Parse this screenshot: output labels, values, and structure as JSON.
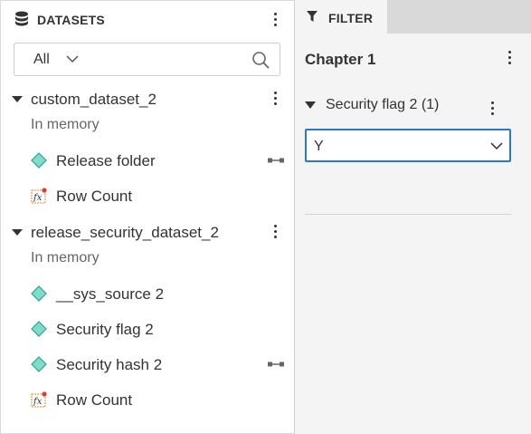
{
  "datasets_panel": {
    "title": "DATASETS",
    "filter": {
      "selected": "All"
    },
    "datasets": [
      {
        "name": "custom_dataset_2",
        "location": "In memory",
        "fields": [
          {
            "label": "Release folder",
            "icon": "attribute-diamond-icon",
            "linked": true
          },
          {
            "label": "Row Count",
            "icon": "fx-metric-icon",
            "linked": false
          }
        ]
      },
      {
        "name": "release_security_dataset_2",
        "location": "In memory",
        "fields": [
          {
            "label": "__sys_source 2",
            "icon": "attribute-diamond-icon",
            "linked": false
          },
          {
            "label": "Security flag 2",
            "icon": "attribute-diamond-icon",
            "linked": false
          },
          {
            "label": "Security hash 2",
            "icon": "attribute-diamond-icon",
            "linked": true
          },
          {
            "label": "Row Count",
            "icon": "fx-metric-icon",
            "linked": false
          }
        ]
      }
    ]
  },
  "filter_panel": {
    "tab_label": "FILTER",
    "chapter_title": "Chapter 1",
    "filter": {
      "name": "Security flag 2 (1)",
      "selected_value": "Y"
    }
  },
  "colors": {
    "diamond_fill": "#7fdccb",
    "diamond_stroke": "#2fa38f",
    "fx_border": "#e28a2b",
    "fx_dot": "#e23b2b",
    "focus_border": "#2a78d6",
    "tab_bar": "#d9d9d9",
    "panel_bg": "#f4f4f4"
  }
}
